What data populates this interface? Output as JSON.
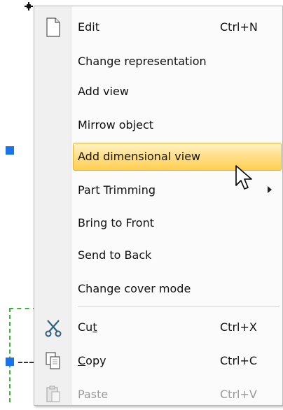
{
  "menu": {
    "items": [
      {
        "label": "Edit",
        "shortcut": "Ctrl+N",
        "icon": "new-document-icon"
      },
      {
        "label": "Change representation"
      },
      {
        "label": "Add view"
      },
      {
        "label": "Mirrow object"
      },
      {
        "label": "Add dimensional view",
        "highlighted": true
      },
      {
        "label": "Part Trimming",
        "has_submenu": true
      },
      {
        "label": "Bring to Front"
      },
      {
        "label": "Send to Back"
      },
      {
        "label": "Change cover mode"
      },
      {
        "label_pre": "Cu",
        "label_accel": "t",
        "label_post": "",
        "shortcut": "Ctrl+X",
        "icon": "scissors-icon"
      },
      {
        "label_pre": "",
        "label_accel": "C",
        "label_post": "opy",
        "shortcut": "Ctrl+C",
        "icon": "copy-icon"
      },
      {
        "label": "Paste",
        "shortcut": "Ctrl+V",
        "icon": "paste-icon",
        "disabled": true
      }
    ]
  },
  "colors": {
    "highlight_top": "#fff4c6",
    "highlight_bottom": "#ffcf52",
    "selection_handle": "#1a73e8",
    "dashed_outline": "#3db33d"
  }
}
